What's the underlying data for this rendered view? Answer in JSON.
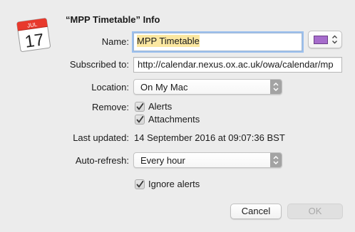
{
  "dialog": {
    "title": "“MPP Timetable” Info",
    "icon": "calendar-app-icon",
    "icon_month": "JUL",
    "icon_day": "17"
  },
  "name": {
    "label": "Name:",
    "value": "MPP Timetable",
    "color_swatch": "#a66ccc"
  },
  "subscribed": {
    "label": "Subscribed to:",
    "value": "http://calendar.nexus.ox.ac.uk/owa/calendar/mp"
  },
  "location": {
    "label": "Location:",
    "value": "On My Mac"
  },
  "remove": {
    "label": "Remove:",
    "alerts": {
      "label": "Alerts",
      "checked": true
    },
    "attachments": {
      "label": "Attachments",
      "checked": true
    }
  },
  "last_updated": {
    "label": "Last updated:",
    "value": "14 September 2016 at 09:07:36 BST"
  },
  "auto_refresh": {
    "label": "Auto-refresh:",
    "value": "Every hour"
  },
  "ignore_alerts": {
    "label": "Ignore alerts",
    "checked": true
  },
  "buttons": {
    "cancel": "Cancel",
    "ok": "OK"
  }
}
